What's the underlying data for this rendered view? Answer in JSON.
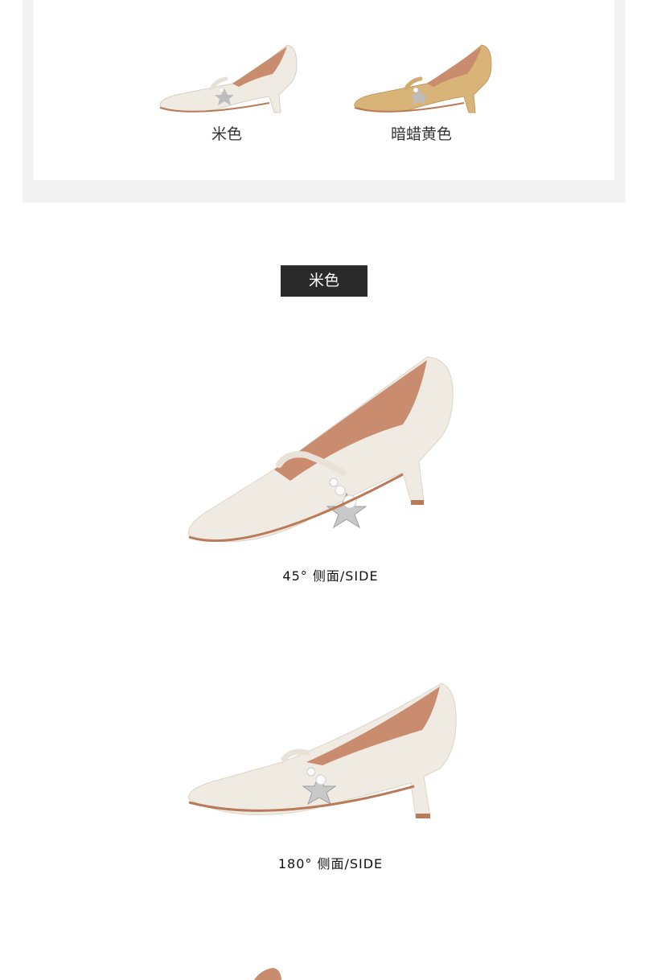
{
  "swatches": [
    {
      "label": "米色",
      "shoe_color": "#efeae2"
    },
    {
      "label": "暗蜡黄色",
      "shoe_color": "#d9b479"
    }
  ],
  "selected_color_tag": "米色",
  "views": [
    {
      "caption": "45° 侧面/SIDE"
    },
    {
      "caption": "180° 侧面/SIDE"
    }
  ],
  "colors": {
    "panel_bg": "#f3f3f3",
    "tag_bg": "#2a2a2a",
    "lining": "#c98c6e",
    "sole": "#b97a5a"
  }
}
